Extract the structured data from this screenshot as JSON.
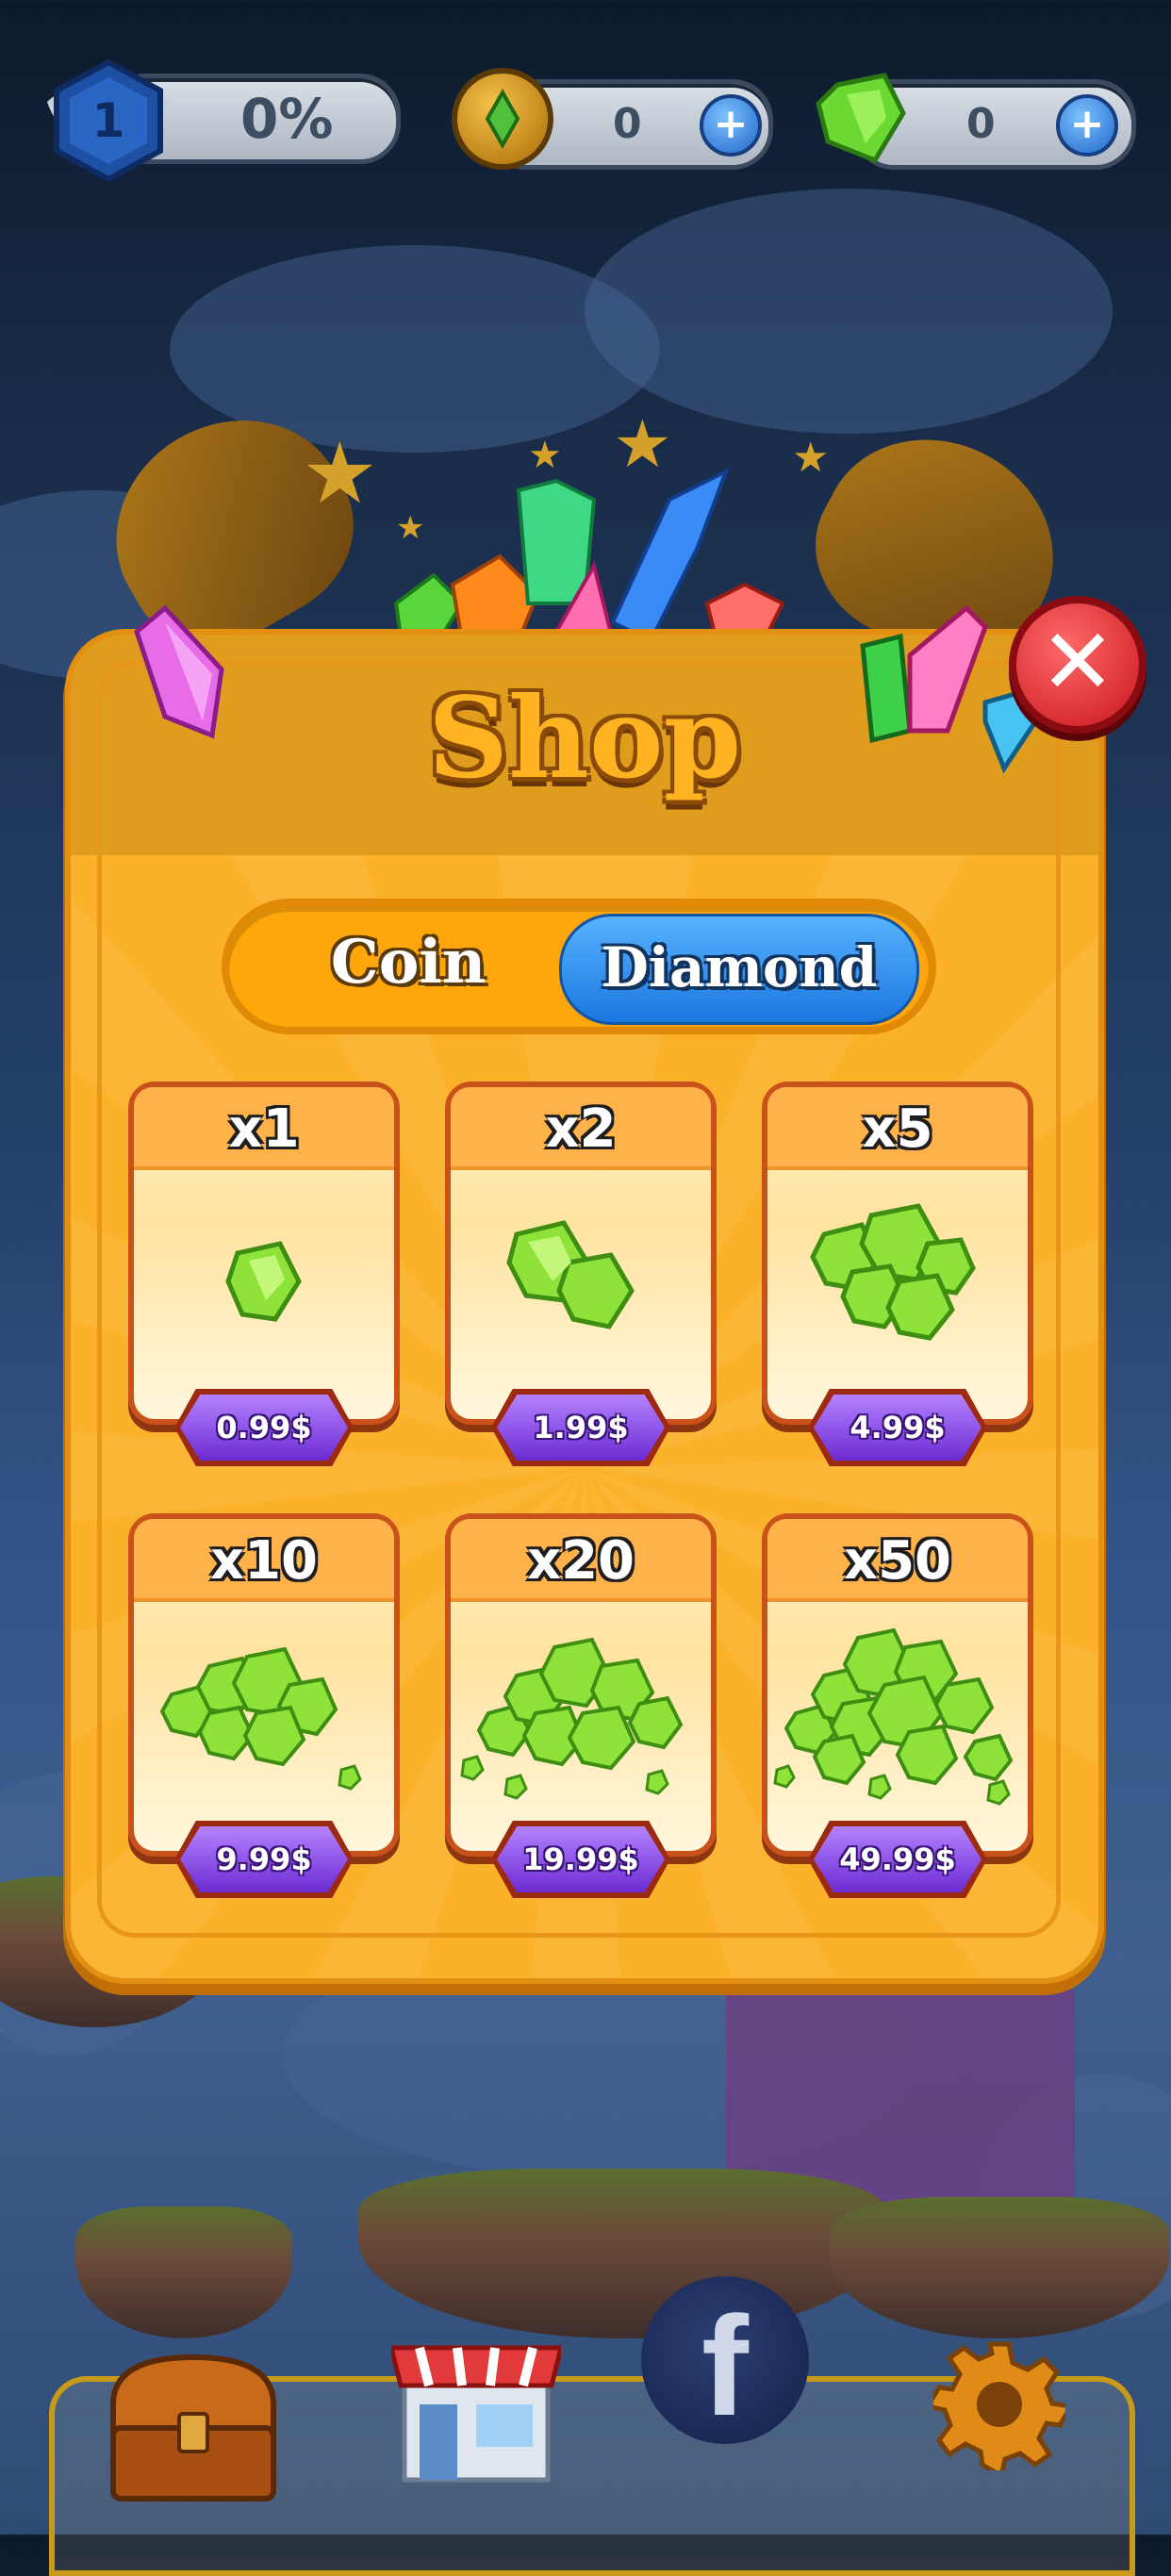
{
  "hud": {
    "level": "1",
    "progress": "0%",
    "coins": "0",
    "diamonds": "0",
    "plus": "+"
  },
  "shop": {
    "title": "Shop",
    "tabs": {
      "coin": "Coin",
      "diamond": "Diamond",
      "active": "Diamond"
    },
    "close_icon": "close-x-icon",
    "close_glyph": "✕",
    "items": [
      {
        "label": "x1",
        "price": "0.99$"
      },
      {
        "label": "x2",
        "price": "1.99$"
      },
      {
        "label": "x5",
        "price": "4.99$"
      },
      {
        "label": "x10",
        "price": "9.99$"
      },
      {
        "label": "x20",
        "price": "19.99$"
      },
      {
        "label": "x50",
        "price": "49.99$"
      }
    ]
  },
  "bottom_nav": {
    "facebook_glyph": "f",
    "icons": [
      "treasure-chest-icon",
      "store-icon",
      "facebook-icon",
      "settings-gear-icon"
    ]
  },
  "colors": {
    "modal": "#fbb22a",
    "tab_active": "#1a77de",
    "price_badge": "#6c2bd3",
    "gem": "#9be33a",
    "close": "#c9151d"
  }
}
